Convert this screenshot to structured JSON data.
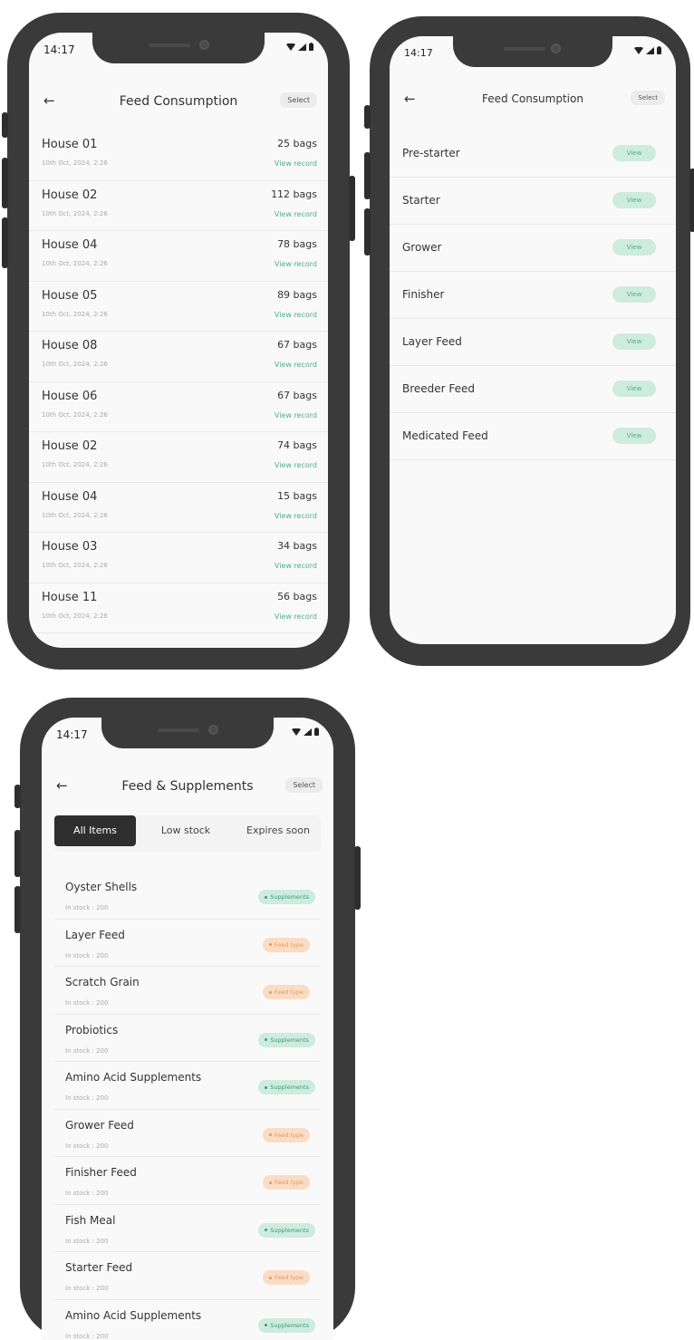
{
  "status_time": "14:17",
  "feed_consumption": {
    "title": "Feed Consumption",
    "back_icon": "←",
    "select_label": "Select",
    "records": [
      {
        "house": "House 01",
        "date": "10th Oct, 2024, 2:26",
        "bags": "25 bags",
        "link": "View record"
      },
      {
        "house": "House 02",
        "date": "10th Oct, 2024, 2:26",
        "bags": "112 bags",
        "link": "View record"
      },
      {
        "house": "House 04",
        "date": "10th Oct, 2024, 2:26",
        "bags": "78 bags",
        "link": "View record"
      },
      {
        "house": "House 05",
        "date": "10th Oct, 2024, 2:26",
        "bags": "89 bags",
        "link": "View record"
      },
      {
        "house": "House 08",
        "date": "10th Oct, 2024, 2:26",
        "bags": "67 bags",
        "link": "View record"
      },
      {
        "house": "House 06",
        "date": "10th Oct, 2024, 2:26",
        "bags": "67 bags",
        "link": "View record"
      },
      {
        "house": "House 02",
        "date": "10th Oct, 2024, 2:26",
        "bags": "74 bags",
        "link": "View record"
      },
      {
        "house": "House 04",
        "date": "10th Oct, 2024, 2:26",
        "bags": "15 bags",
        "link": "View record"
      },
      {
        "house": "House 03",
        "date": "10th Oct, 2024, 2:26",
        "bags": "34 bags",
        "link": "View record"
      },
      {
        "house": "House 11",
        "date": "10th Oct, 2024, 2:26",
        "bags": "56 bags",
        "link": "View record"
      }
    ]
  },
  "feed_types": {
    "title": "Feed Consumption",
    "back_icon": "←",
    "select_label": "Select",
    "view_label": "View",
    "items": [
      "Pre-starter",
      "Starter",
      "Grower",
      "Finisher",
      "Layer Feed",
      "Breeder Feed",
      "Medicated Feed"
    ]
  },
  "feed_supplements": {
    "title": "Feed & Supplements",
    "back_icon": "←",
    "select_label": "Select",
    "tabs": [
      "All Items",
      "Low stock",
      "Expires soon"
    ],
    "active_tab": 0,
    "items": [
      {
        "name": "Oyster Shells",
        "stock": "In stock : 200",
        "badge": "Supplements",
        "kind": "supp"
      },
      {
        "name": "Layer Feed",
        "stock": "In stock : 200",
        "badge": "Feed type",
        "kind": "feed"
      },
      {
        "name": "Scratch Grain",
        "stock": "In stock : 200",
        "badge": "Feed type",
        "kind": "feed"
      },
      {
        "name": "Probiotics",
        "stock": "In stock : 200",
        "badge": "Supplements",
        "kind": "supp"
      },
      {
        "name": "Amino Acid Supplements",
        "stock": "In stock : 200",
        "badge": "Supplements",
        "kind": "supp"
      },
      {
        "name": "Grower Feed",
        "stock": "In stock : 200",
        "badge": "Feed type",
        "kind": "feed"
      },
      {
        "name": "Finisher Feed",
        "stock": "In stock : 200",
        "badge": "Feed type",
        "kind": "feed"
      },
      {
        "name": "Fish Meal",
        "stock": "In stock : 200",
        "badge": "Supplements",
        "kind": "supp"
      },
      {
        "name": "Starter Feed",
        "stock": "In stock : 200",
        "badge": "Feed type",
        "kind": "feed"
      },
      {
        "name": "Amino Acid Supplements",
        "stock": "In stock : 200",
        "badge": "Supplements",
        "kind": "supp"
      }
    ]
  },
  "icons": {
    "status": [
      "wifi-icon",
      "signal-icon",
      "battery-icon"
    ],
    "back": "back-arrow-icon"
  },
  "colors": {
    "accent_green": "#4fae8a",
    "green_bg": "#cdebdf",
    "orange_bg": "#fbdcc2",
    "orange_text": "#e39a5f",
    "dark": "#2e2e2e"
  }
}
